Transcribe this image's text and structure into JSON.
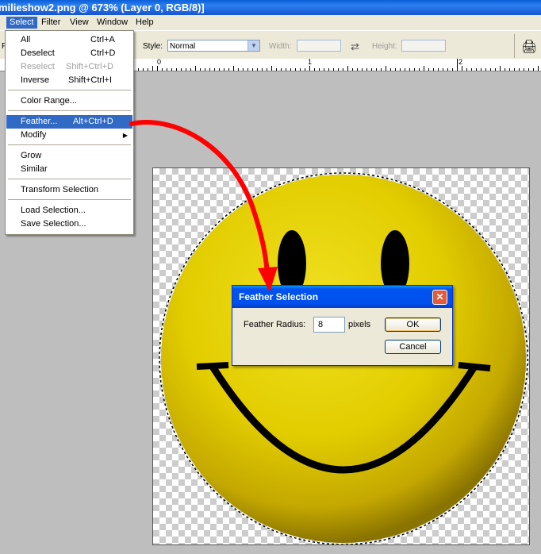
{
  "window": {
    "title": "milieshow2.png @ 673% (Layer 0, RGB/8)]"
  },
  "menubar": {
    "items": [
      "Select",
      "Filter",
      "View",
      "Window",
      "Help"
    ],
    "active": "Select"
  },
  "options_bar": {
    "left_clip": "F",
    "style_label": "Style:",
    "style_value": "Normal",
    "width_label": "Width:",
    "height_label": "Height:",
    "swap_icon": "swap-arrows-icon",
    "palette_icon": "palette-well-icon"
  },
  "ruler": {
    "labels": [
      "0",
      "1",
      "2"
    ]
  },
  "select_menu": {
    "items": [
      {
        "label": "All",
        "shortcut": "Ctrl+A",
        "enabled": true
      },
      {
        "label": "Deselect",
        "shortcut": "Ctrl+D",
        "enabled": true
      },
      {
        "label": "Reselect",
        "shortcut": "Shift+Ctrl+D",
        "enabled": false
      },
      {
        "label": "Inverse",
        "shortcut": "Shift+Ctrl+I",
        "enabled": true
      },
      {
        "label": "Color Range...",
        "shortcut": "",
        "enabled": true
      },
      {
        "label": "Feather...",
        "shortcut": "Alt+Ctrl+D",
        "enabled": true,
        "highlighted": true
      },
      {
        "label": "Modify",
        "shortcut": "",
        "enabled": true,
        "submenu": true
      },
      {
        "label": "Grow",
        "shortcut": "",
        "enabled": true
      },
      {
        "label": "Similar",
        "shortcut": "",
        "enabled": true
      },
      {
        "label": "Transform Selection",
        "shortcut": "",
        "enabled": true
      },
      {
        "label": "Load Selection...",
        "shortcut": "",
        "enabled": true
      },
      {
        "label": "Save Selection...",
        "shortcut": "",
        "enabled": true
      }
    ]
  },
  "dialog": {
    "title": "Feather Selection",
    "radius_label": "Feather Radius:",
    "radius_value": "8",
    "unit": "pixels",
    "ok": "OK",
    "cancel": "Cancel",
    "close_icon": "close-icon"
  },
  "colors": {
    "accent": "#316ac5",
    "title_bar": "#0a5fd8",
    "annotation_arrow": "#ff0000",
    "face": "#e8d400"
  }
}
